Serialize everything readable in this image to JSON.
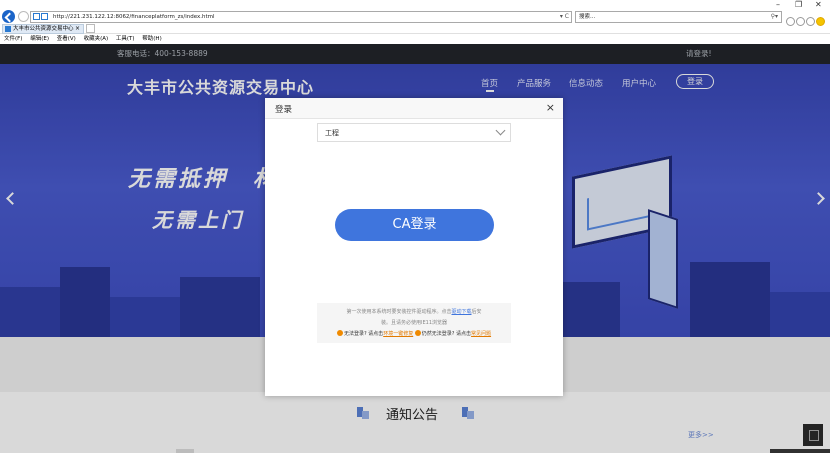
{
  "browser": {
    "url": "http://221.231.122.12:8062/financeplatform_zs/index.html",
    "search_placeholder": "搜索...",
    "tab_title": "大丰市公共资源交易中心",
    "menu": [
      "文件(F)",
      "编辑(E)",
      "查看(V)",
      "收藏夹(A)",
      "工具(T)",
      "帮助(H)"
    ]
  },
  "topbar": {
    "phone": "客服电话：400-153-8889",
    "login": "请登录!"
  },
  "header": {
    "site_title": "大丰市公共资源交易中心",
    "nav": [
      "首页",
      "产品服务",
      "信息动态",
      "用户中心"
    ],
    "register": "登录"
  },
  "hero": {
    "slogan_line1": "无需抵押　材",
    "slogan_line2": "无需上门　快"
  },
  "notice": {
    "title": "通知公告",
    "more": "更多>>"
  },
  "modal": {
    "title": "登录",
    "close": "×",
    "select_value": "工程",
    "ca_button": "CA登录",
    "tip_line1_a": "第一次使用本系统时要安装控件驱动程序。点击",
    "tip_line1_link": "驱动下载",
    "tip_line1_b": "后安",
    "tip_line2": "装。且请务必使用IE11浏览器",
    "tip_q1": "无法登录? 请点击",
    "tip_q1_link": "环境一键修复",
    "tip_q2": "仍然无法登录? 请点击",
    "tip_q2_link": "常见问题"
  }
}
